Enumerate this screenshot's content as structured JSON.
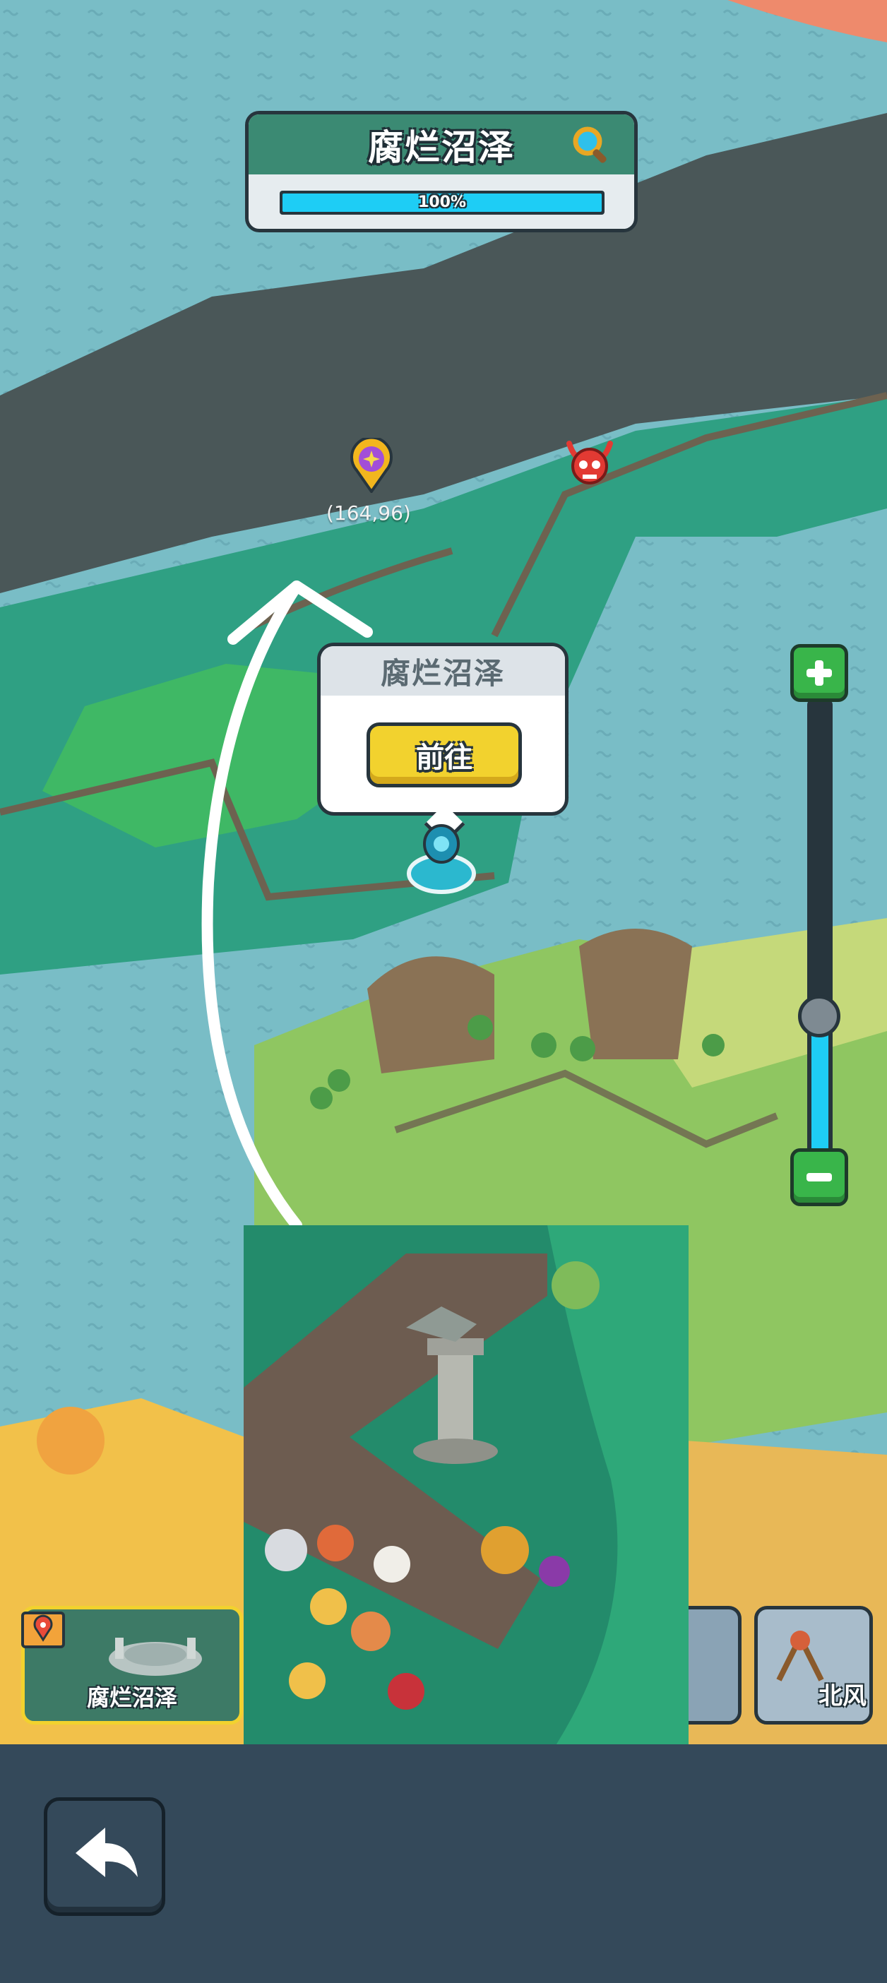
{
  "header": {
    "area_name": "腐烂沼泽",
    "progress_label": "100%",
    "progress_value": 1.0
  },
  "map": {
    "coordinate": "(164,96)"
  },
  "popup": {
    "title": "腐烂沼泽",
    "go_label": "前往"
  },
  "zoom": {
    "level": 0.33
  },
  "area_cards": [
    {
      "label": "腐烂沼泽",
      "selected": true
    },
    {
      "label": "",
      "selected": false
    },
    {
      "label": "北风",
      "selected": false
    }
  ],
  "colors": {
    "accent": "#1ecdf5",
    "button_yellow": "#f2d22e",
    "zoom_green": "#39b54a",
    "panel_dark": "#27353d"
  },
  "icons": [
    "search-icon",
    "location-pin-icon",
    "demon-skull-icon",
    "zoom-in-icon",
    "zoom-out-icon",
    "back-arrow-icon",
    "map-pin-icon"
  ]
}
